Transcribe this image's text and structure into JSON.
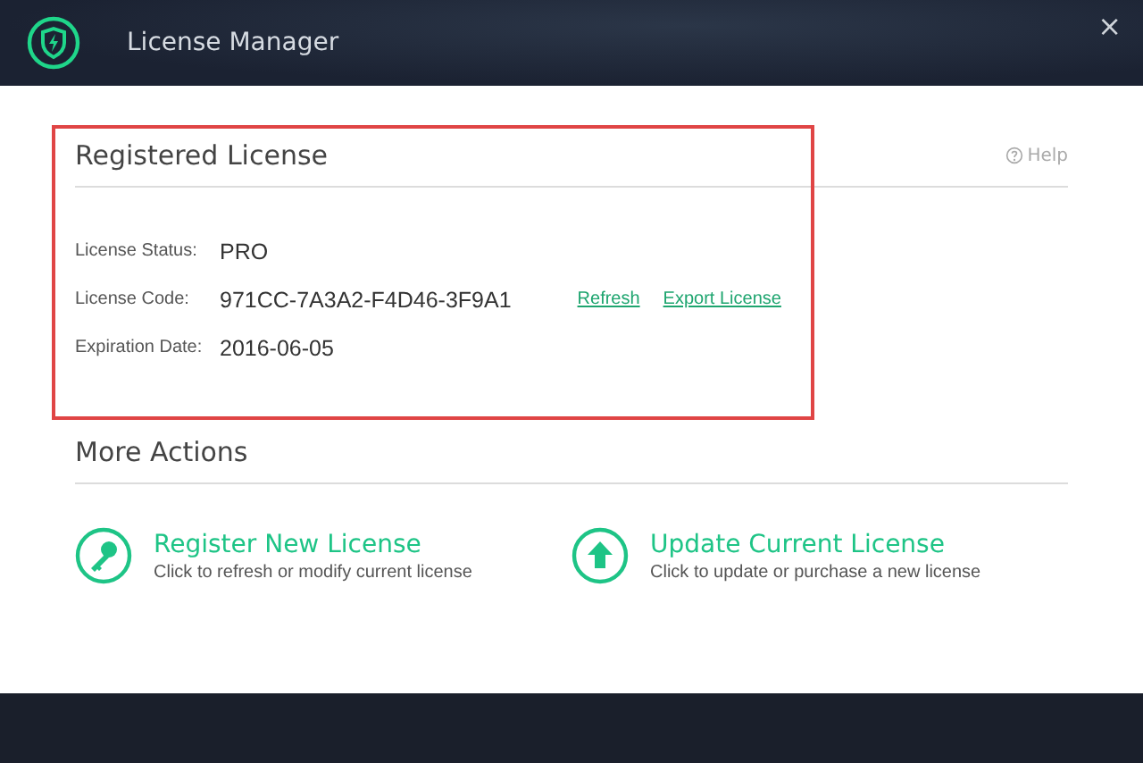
{
  "window": {
    "title": "License Manager",
    "close": "×"
  },
  "registered": {
    "heading": "Registered License",
    "help": "Help",
    "fields": [
      {
        "label": "License Status:",
        "value": "PRO"
      },
      {
        "label": "License Code:",
        "value": "971CC-7A3A2-F4D46-3F9A1",
        "links": [
          "Refresh",
          "Export License"
        ]
      },
      {
        "label": "Expiration Date:",
        "value": "2016-06-05"
      }
    ]
  },
  "more_actions": {
    "heading": "More Actions",
    "actions": [
      {
        "kind": "key",
        "title": "Register New License",
        "description": "Click to refresh or modify current license"
      },
      {
        "kind": "upload",
        "title": "Update Current License",
        "description": "Click to update or purchase a new license"
      }
    ]
  }
}
